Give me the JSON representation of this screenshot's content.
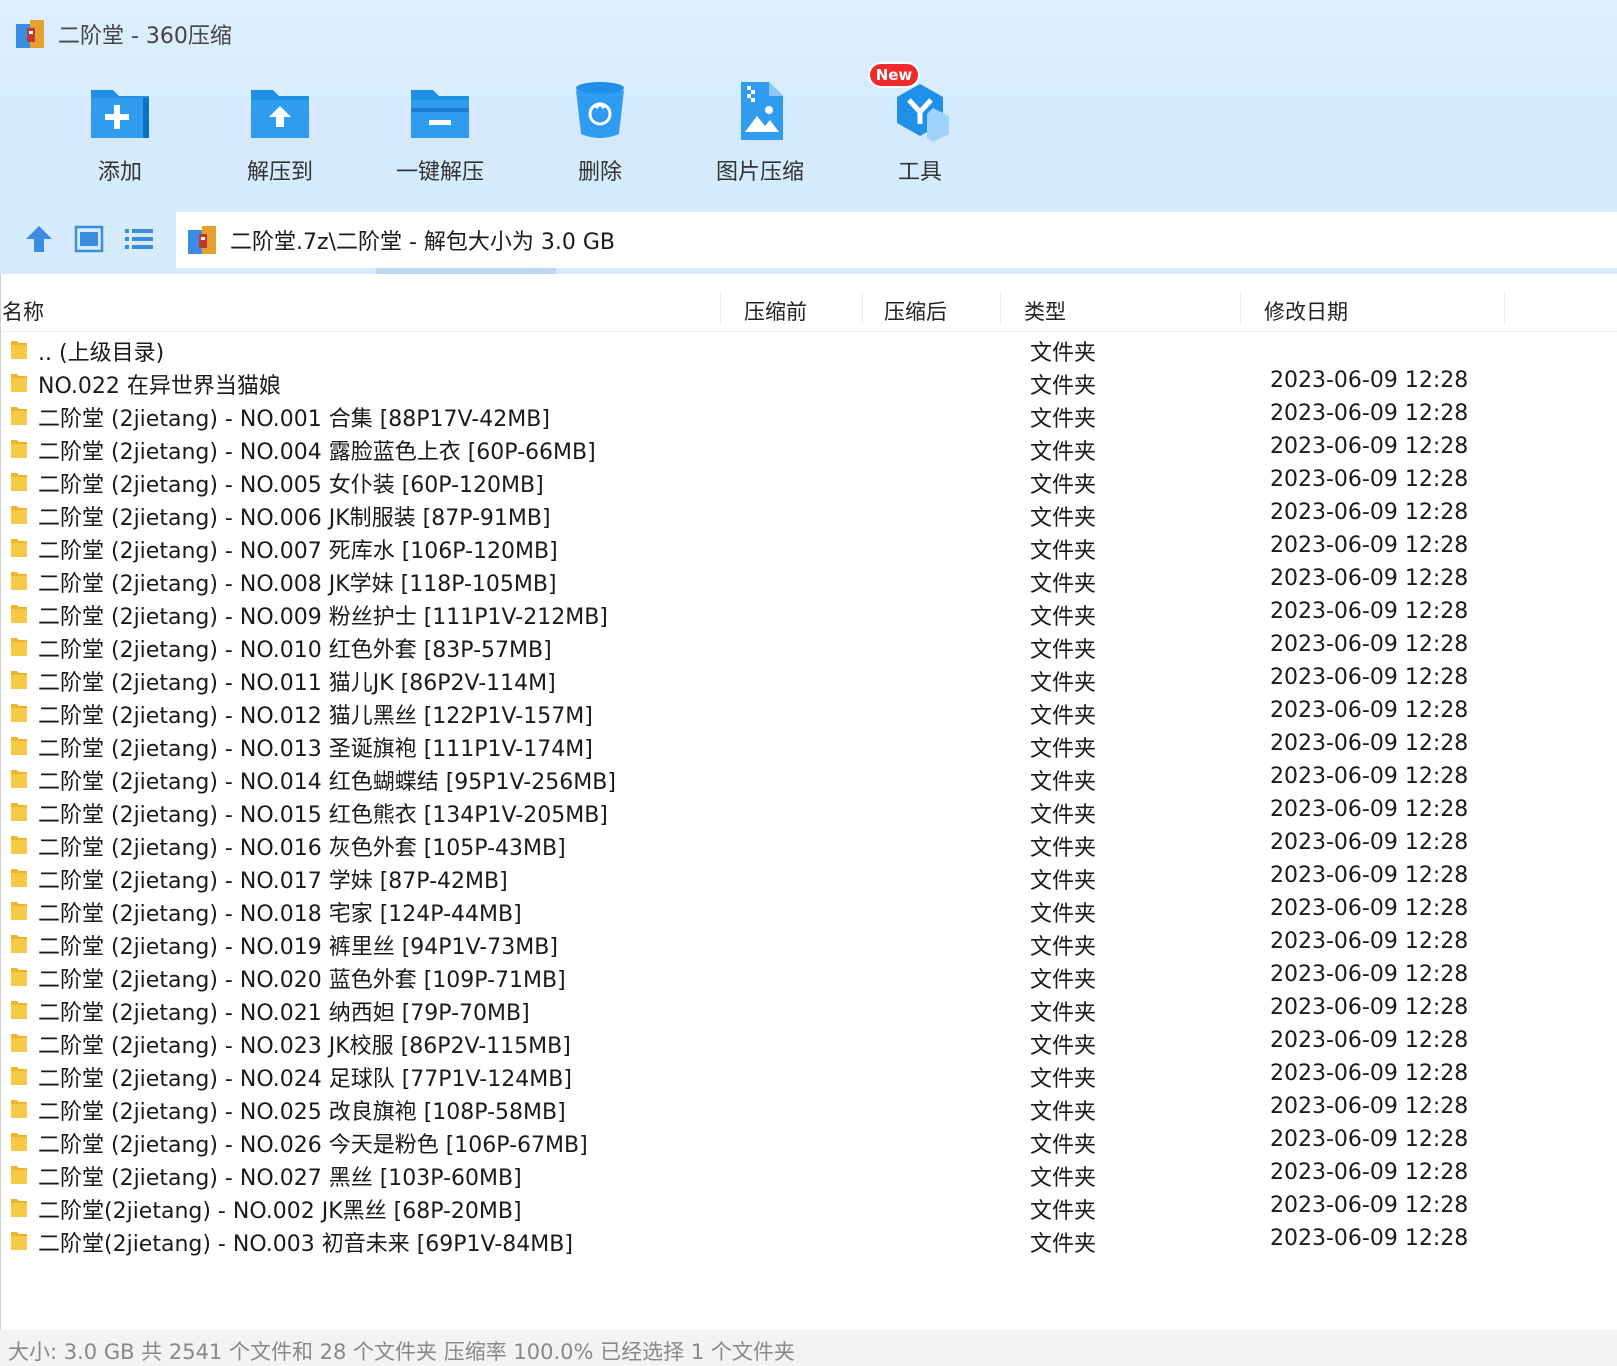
{
  "window": {
    "title": "二阶堂 - 360压缩"
  },
  "toolbar": {
    "items": [
      {
        "label": "添加",
        "icon": "add-folder-icon"
      },
      {
        "label": "解压到",
        "icon": "extract-to-icon"
      },
      {
        "label": "一键解压",
        "icon": "one-click-extract-icon"
      },
      {
        "label": "删除",
        "icon": "recycle-bin-icon"
      },
      {
        "label": "图片压缩",
        "icon": "image-compress-icon"
      },
      {
        "label": "工具",
        "icon": "tools-icon"
      }
    ],
    "new_badge": "New"
  },
  "navbar": {
    "path": "二阶堂.7z\\二阶堂 - 解包大小为 3.0 GB"
  },
  "columns": {
    "name": "名称",
    "before": "压缩前",
    "after": "压缩后",
    "type": "类型",
    "modified": "修改日期"
  },
  "files": [
    {
      "name": ".. (上级目录)",
      "type": "文件夹",
      "date": ""
    },
    {
      "name": "NO.022 在异世界当猫娘",
      "type": "文件夹",
      "date": "2023-06-09 12:28"
    },
    {
      "name": "二阶堂 (2jietang) - NO.001 合集 [88P17V-42MB]",
      "type": "文件夹",
      "date": "2023-06-09 12:28"
    },
    {
      "name": "二阶堂 (2jietang) - NO.004 露脸蓝色上衣 [60P-66MB]",
      "type": "文件夹",
      "date": "2023-06-09 12:28"
    },
    {
      "name": "二阶堂 (2jietang) - NO.005 女仆装 [60P-120MB]",
      "type": "文件夹",
      "date": "2023-06-09 12:28"
    },
    {
      "name": "二阶堂 (2jietang) - NO.006 JK制服装 [87P-91MB]",
      "type": "文件夹",
      "date": "2023-06-09 12:28"
    },
    {
      "name": "二阶堂 (2jietang) - NO.007 死库水 [106P-120MB]",
      "type": "文件夹",
      "date": "2023-06-09 12:28"
    },
    {
      "name": "二阶堂 (2jietang) - NO.008 JK学妹 [118P-105MB]",
      "type": "文件夹",
      "date": "2023-06-09 12:28"
    },
    {
      "name": "二阶堂 (2jietang) - NO.009 粉丝护士 [111P1V-212MB]",
      "type": "文件夹",
      "date": "2023-06-09 12:28"
    },
    {
      "name": "二阶堂 (2jietang) - NO.010 红色外套 [83P-57MB]",
      "type": "文件夹",
      "date": "2023-06-09 12:28"
    },
    {
      "name": "二阶堂 (2jietang) - NO.011 猫儿JK [86P2V-114M]",
      "type": "文件夹",
      "date": "2023-06-09 12:28"
    },
    {
      "name": "二阶堂 (2jietang) - NO.012 猫儿黑丝 [122P1V-157M]",
      "type": "文件夹",
      "date": "2023-06-09 12:28"
    },
    {
      "name": "二阶堂 (2jietang) - NO.013 圣诞旗袍 [111P1V-174M]",
      "type": "文件夹",
      "date": "2023-06-09 12:28"
    },
    {
      "name": "二阶堂 (2jietang) - NO.014 红色蝴蝶结 [95P1V-256MB]",
      "type": "文件夹",
      "date": "2023-06-09 12:28"
    },
    {
      "name": "二阶堂 (2jietang) - NO.015 红色熊衣 [134P1V-205MB]",
      "type": "文件夹",
      "date": "2023-06-09 12:28"
    },
    {
      "name": "二阶堂 (2jietang) - NO.016 灰色外套 [105P-43MB]",
      "type": "文件夹",
      "date": "2023-06-09 12:28"
    },
    {
      "name": "二阶堂 (2jietang) - NO.017 学妹 [87P-42MB]",
      "type": "文件夹",
      "date": "2023-06-09 12:28"
    },
    {
      "name": "二阶堂 (2jietang) - NO.018 宅家 [124P-44MB]",
      "type": "文件夹",
      "date": "2023-06-09 12:28"
    },
    {
      "name": "二阶堂 (2jietang) - NO.019 裤里丝 [94P1V-73MB]",
      "type": "文件夹",
      "date": "2023-06-09 12:28"
    },
    {
      "name": "二阶堂 (2jietang) - NO.020 蓝色外套 [109P-71MB]",
      "type": "文件夹",
      "date": "2023-06-09 12:28"
    },
    {
      "name": "二阶堂 (2jietang) - NO.021 纳西妲 [79P-70MB]",
      "type": "文件夹",
      "date": "2023-06-09 12:28"
    },
    {
      "name": "二阶堂 (2jietang) - NO.023 JK校服 [86P2V-115MB]",
      "type": "文件夹",
      "date": "2023-06-09 12:28"
    },
    {
      "name": "二阶堂 (2jietang) - NO.024 足球队 [77P1V-124MB]",
      "type": "文件夹",
      "date": "2023-06-09 12:28"
    },
    {
      "name": "二阶堂 (2jietang) - NO.025 改良旗袍 [108P-58MB]",
      "type": "文件夹",
      "date": "2023-06-09 12:28"
    },
    {
      "name": "二阶堂 (2jietang) - NO.026 今天是粉色 [106P-67MB]",
      "type": "文件夹",
      "date": "2023-06-09 12:28"
    },
    {
      "name": "二阶堂 (2jietang) - NO.027 黑丝 [103P-60MB]",
      "type": "文件夹",
      "date": "2023-06-09 12:28"
    },
    {
      "name": "二阶堂(2jietang) - NO.002 JK黑丝 [68P-20MB]",
      "type": "文件夹",
      "date": "2023-06-09 12:28"
    },
    {
      "name": "二阶堂(2jietang) - NO.003 初音未来 [69P1V-84MB]",
      "type": "文件夹",
      "date": "2023-06-09 12:28"
    }
  ],
  "status": {
    "text": "大小: 3.0 GB 共 2541 个文件和 28 个文件夹 压缩率 100.0% 已经选择 1 个文件夹"
  },
  "colors": {
    "accent": "#2196f3",
    "toolbar_bg": "#d6ebfb",
    "folder": "#f5c342",
    "badge": "#ef2b2b"
  }
}
